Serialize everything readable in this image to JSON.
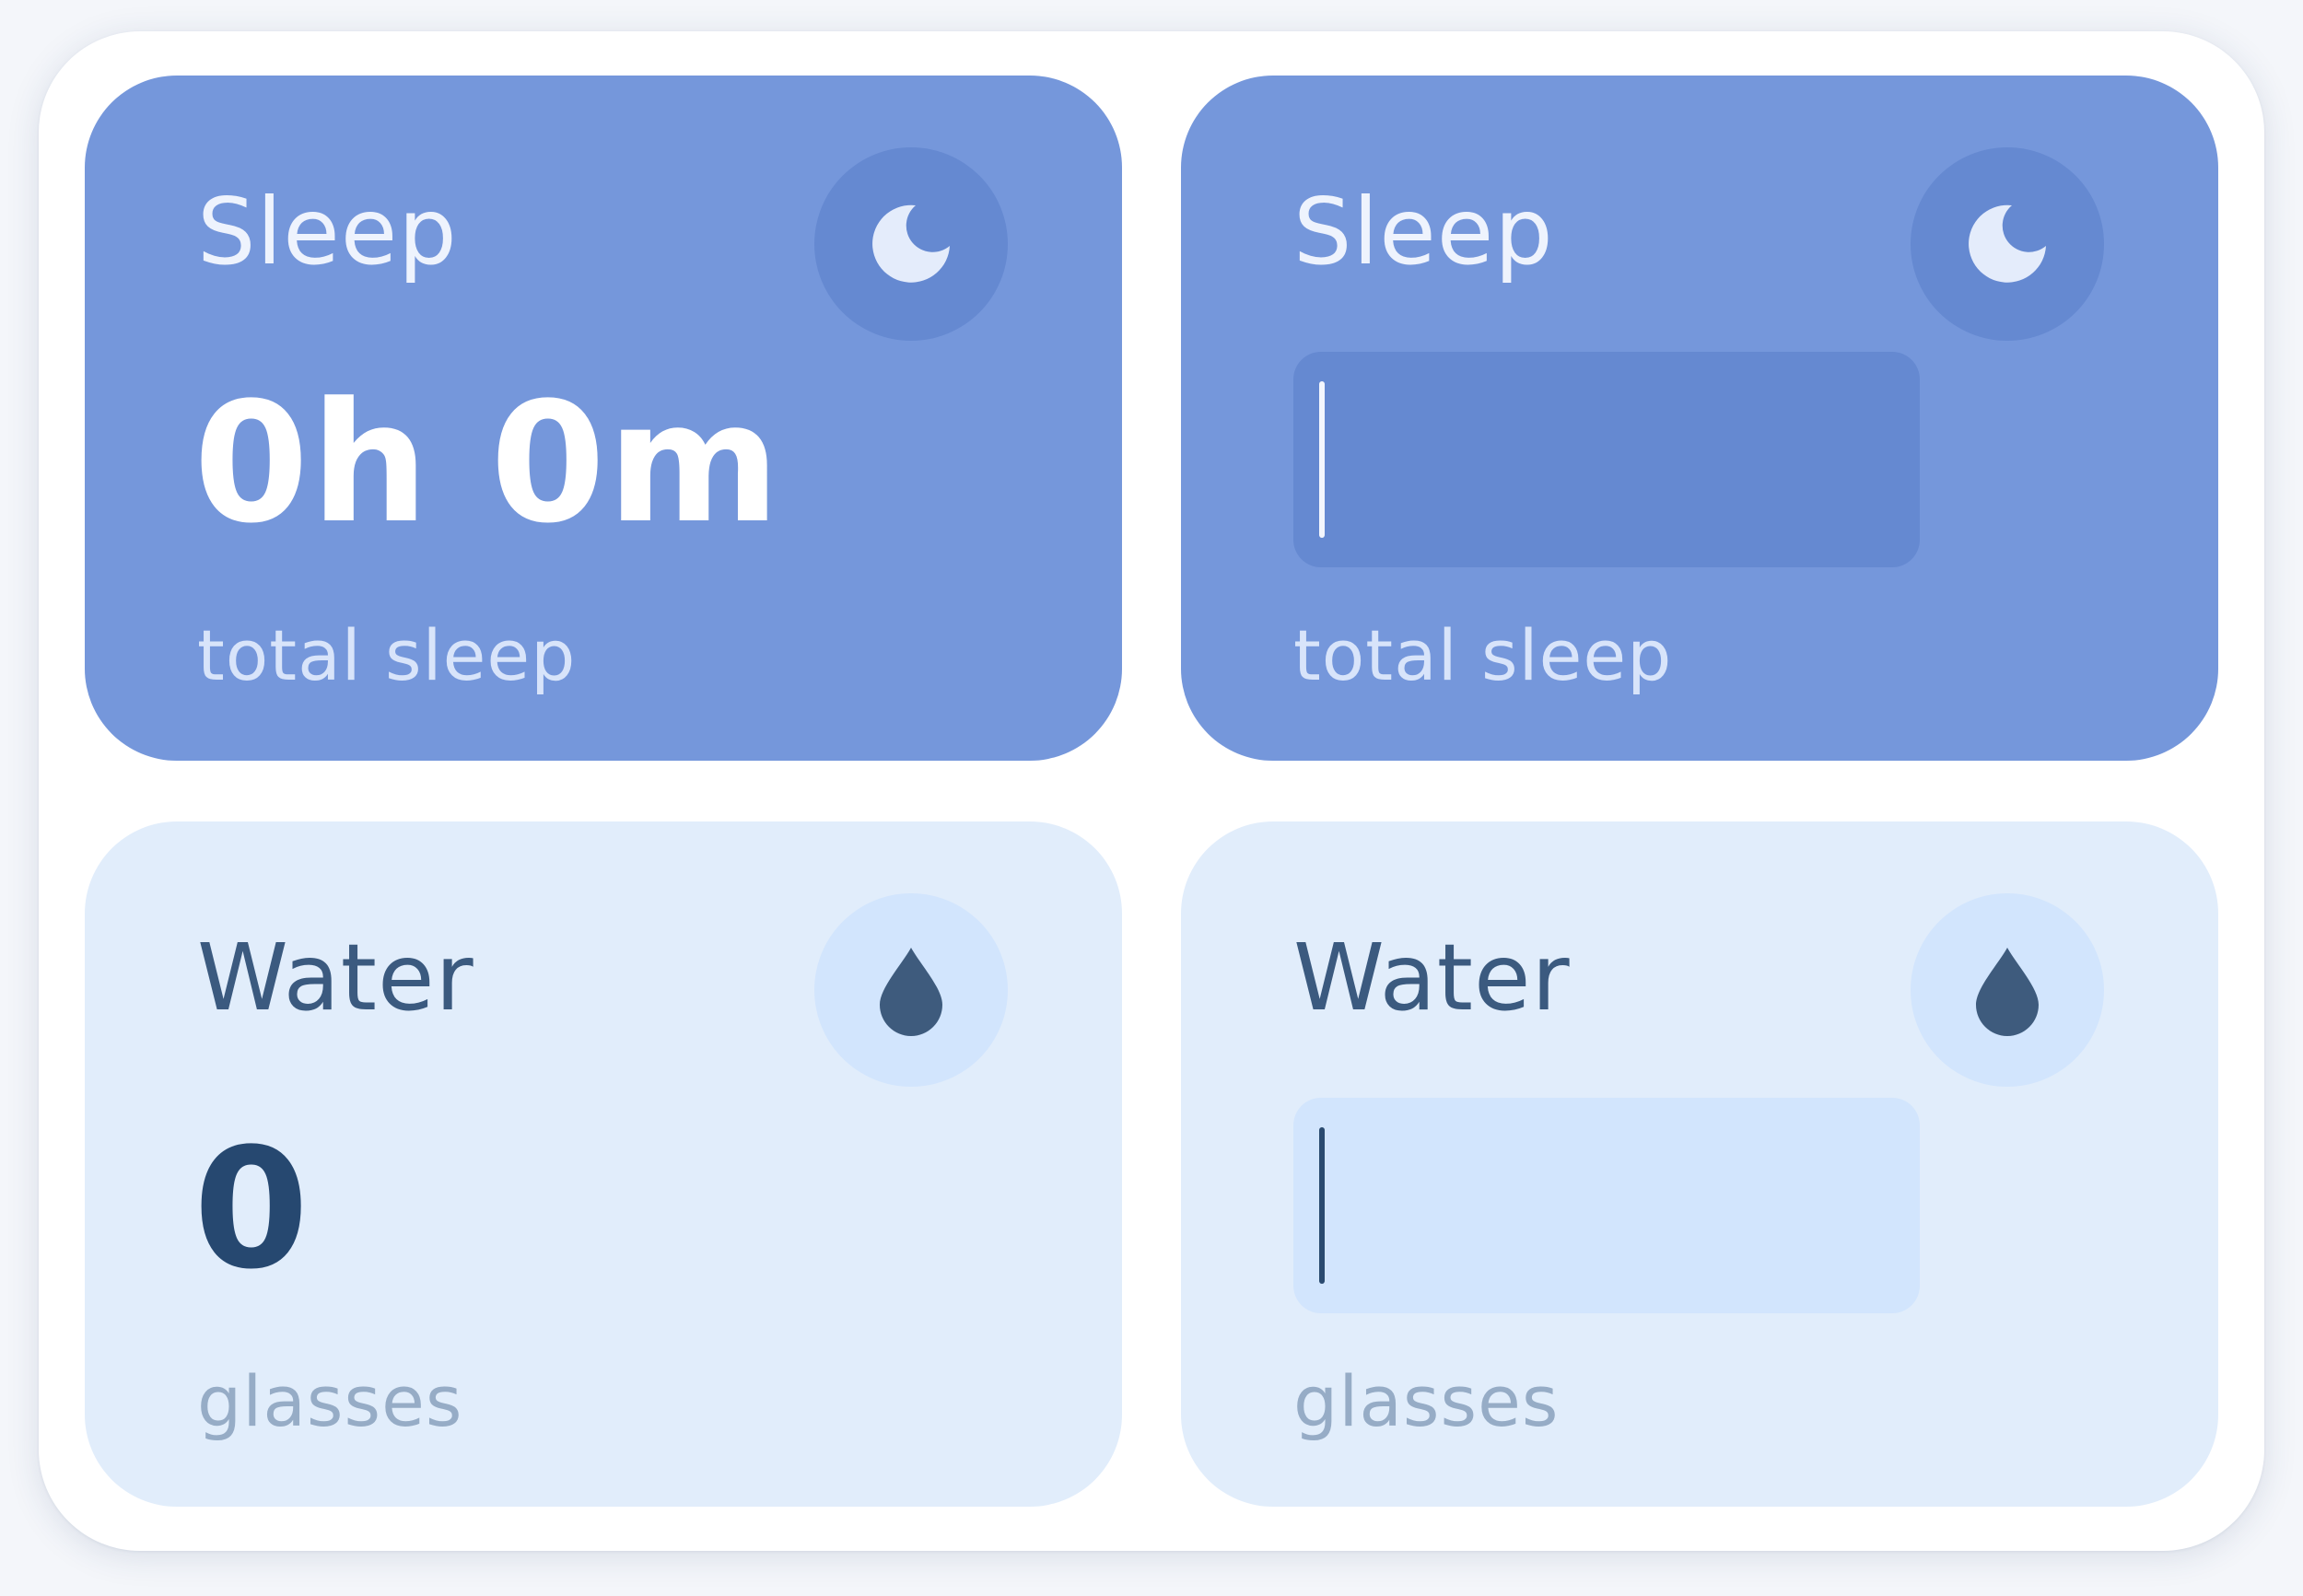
{
  "cards": [
    {
      "title": "Sleep",
      "icon": "moon-icon",
      "value": "0h 0m",
      "caption": "total sleep",
      "mode": "display"
    },
    {
      "title": "Sleep",
      "icon": "moon-icon",
      "value": "",
      "caption": "total sleep",
      "mode": "edit"
    },
    {
      "title": "Water",
      "icon": "water-drop-icon",
      "value": "0",
      "caption": "glasses",
      "mode": "display"
    },
    {
      "title": "Water",
      "icon": "water-drop-icon",
      "value": "",
      "caption": "glasses",
      "mode": "edit"
    }
  ],
  "colors": {
    "sleep_card": "#7597db",
    "sleep_icon_bg": "#6589d1",
    "water_card": "#e1edfb",
    "water_icon_bg": "#d2e5fd",
    "water_text": "#264870"
  }
}
